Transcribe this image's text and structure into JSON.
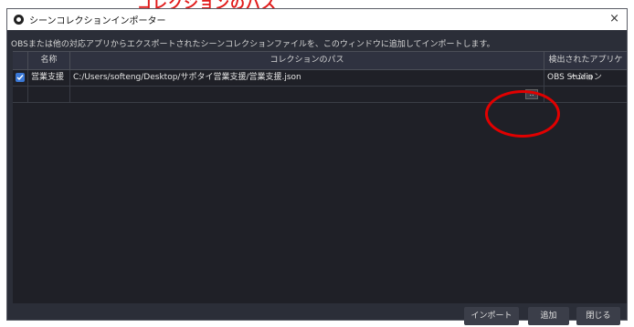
{
  "banner": {
    "text": "コレクションのパス"
  },
  "window": {
    "title": "シーンコレクションインポーター",
    "close_glyph": "×"
  },
  "description": "OBSまたは他の対応アプリからエクスポートされたシーンコレクションファイルを、このウィンドウに追加してインポートします。",
  "table": {
    "headers": {
      "name": "名称",
      "path": "コレクションのパス",
      "app": "検出されたアプリケーション"
    },
    "rows": [
      {
        "checked": true,
        "name": "営業支援",
        "path": "C:/Users/softeng/Desktop/サポタイ営業支援/営業支援.json",
        "app": "OBS Studio"
      }
    ],
    "browse_label": ".."
  },
  "buttons": {
    "import": "インポート",
    "add": "追加",
    "close": "閉じる"
  },
  "colors": {
    "accent": "#3a78d6",
    "annotation": "#e10000"
  }
}
